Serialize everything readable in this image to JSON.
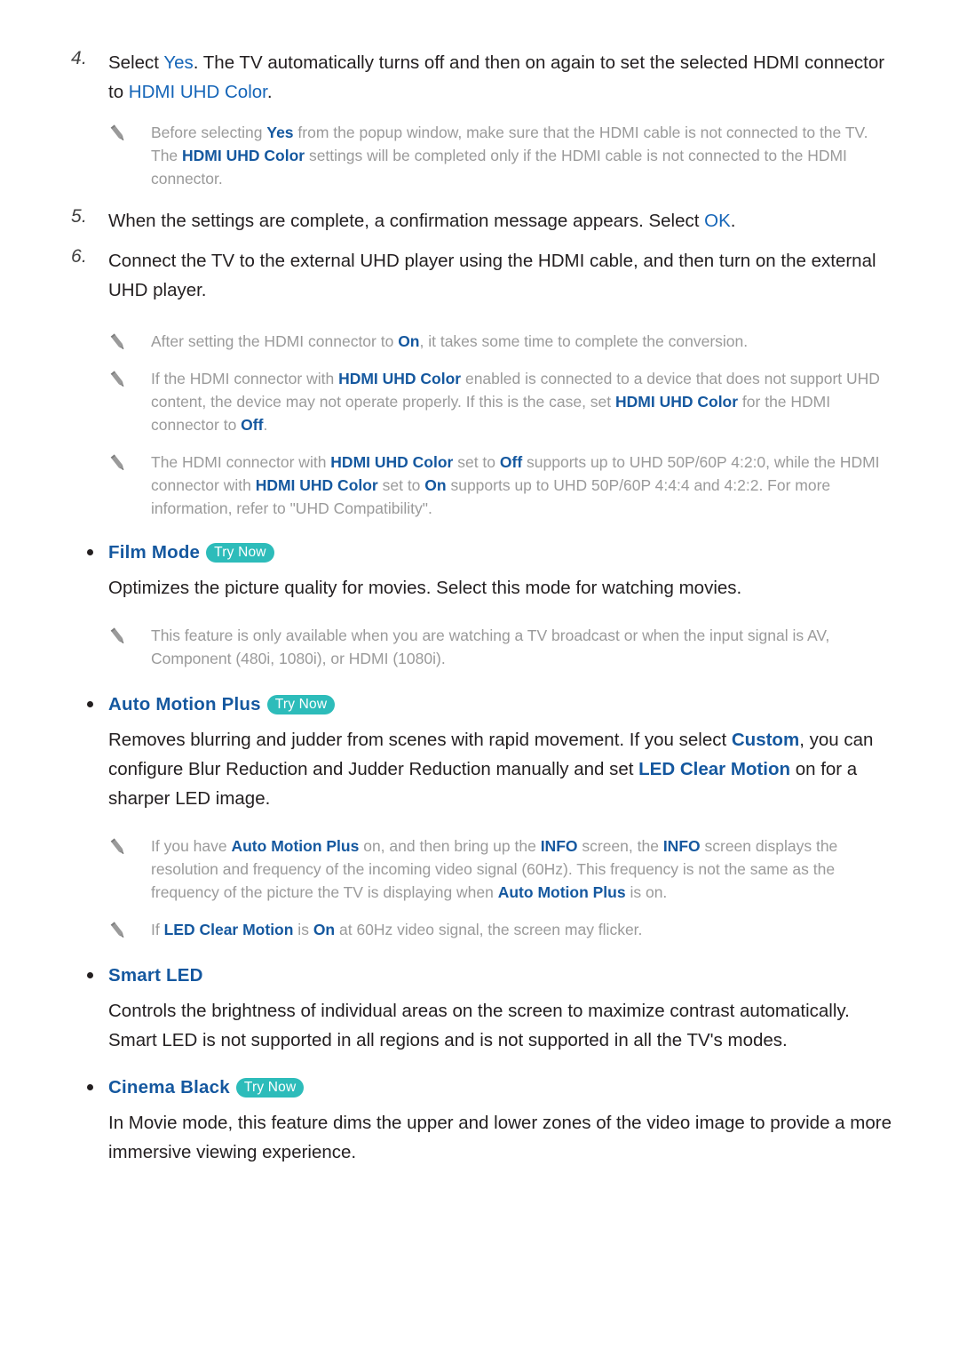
{
  "page": {
    "accent_blue": "#1565b8",
    "accent_blue_bold": "#15589f",
    "badge_teal": "#2dbcba",
    "note_gray": "#9a9a9a",
    "body_dark": "#231f20"
  },
  "steps": [
    {
      "number": "4.",
      "text_before": "Select ",
      "link1": "Yes",
      "text_mid": ". The TV automatically turns off and then on again to set the selected HDMI connector to ",
      "link2": "HDMI UHD Color",
      "text_after": "."
    },
    {
      "number": "5.",
      "text_before": "When the settings are complete, a confirmation message appears. Select ",
      "link1": "OK",
      "text_mid": "",
      "link2": "",
      "text_after": "."
    },
    {
      "number": "6.",
      "text_before": "Connect the TV to the external UHD player using the HDMI cable, and then turn on the external UHD player.",
      "link1": "",
      "text_mid": "",
      "link2": "",
      "text_after": ""
    }
  ],
  "notes": {
    "note_step4": {
      "icon": "pencil-icon",
      "segments": [
        {
          "t": "Before selecting ",
          "b": false
        },
        {
          "t": "Yes",
          "b": true
        },
        {
          "t": " from the popup window, make sure that the HDMI cable is not connected to the TV. The ",
          "b": false
        },
        {
          "t": "HDMI UHD Color",
          "b": true
        },
        {
          "t": " settings will be completed only if the HDMI cable is not connected to the HDMI connector.",
          "b": false
        }
      ]
    },
    "note_step6_a": {
      "icon": "pencil-icon",
      "segments": [
        {
          "t": "After setting the HDMI connector to ",
          "b": false
        },
        {
          "t": "On",
          "b": true
        },
        {
          "t": ", it takes some time to complete the conversion.",
          "b": false
        }
      ]
    },
    "note_step6_b": {
      "icon": "pencil-icon",
      "segments": [
        {
          "t": "If the HDMI connector with ",
          "b": false
        },
        {
          "t": "HDMI UHD Color",
          "b": true
        },
        {
          "t": " enabled is connected to a device that does not support UHD content, the device may not operate properly. If this is the case, set ",
          "b": false
        },
        {
          "t": "HDMI UHD Color",
          "b": true
        },
        {
          "t": " for the HDMI connector to ",
          "b": false
        },
        {
          "t": "Off",
          "b": true
        },
        {
          "t": ".",
          "b": false
        }
      ]
    },
    "note_step6_c": {
      "icon": "pencil-icon",
      "segments": [
        {
          "t": "The HDMI connector with ",
          "b": false
        },
        {
          "t": "HDMI UHD Color",
          "b": true
        },
        {
          "t": " set to ",
          "b": false
        },
        {
          "t": "Off",
          "b": true
        },
        {
          "t": " supports up to UHD 50P/60P 4:2:0, while the HDMI connector with ",
          "b": false
        },
        {
          "t": "HDMI UHD Color",
          "b": true
        },
        {
          "t": " set to ",
          "b": false
        },
        {
          "t": "On",
          "b": true
        },
        {
          "t": " supports up to UHD 50P/60P 4:4:4 and 4:2:2. For more information, refer to \"UHD Compatibility\".",
          "b": false
        }
      ]
    },
    "note_film_mode": {
      "icon": "pencil-icon",
      "segments": [
        {
          "t": "This feature is only available when you are watching a TV broadcast or when the input signal is AV, Component (480i, 1080i), or HDMI (1080i).",
          "b": false
        }
      ]
    },
    "note_amp_a": {
      "icon": "pencil-icon",
      "segments": [
        {
          "t": "If you have ",
          "b": false
        },
        {
          "t": "Auto Motion Plus",
          "b": true
        },
        {
          "t": " on, and then bring up the ",
          "b": false
        },
        {
          "t": "INFO",
          "b": true
        },
        {
          "t": " screen, the ",
          "b": false
        },
        {
          "t": "INFO",
          "b": true
        },
        {
          "t": " screen displays the resolution and frequency of the incoming video signal (60Hz). This frequency is not the same as the frequency of the picture the TV is displaying when ",
          "b": false
        },
        {
          "t": "Auto Motion Plus",
          "b": true
        },
        {
          "t": " is on.",
          "b": false
        }
      ]
    },
    "note_amp_b": {
      "icon": "pencil-icon",
      "segments": [
        {
          "t": "If ",
          "b": false
        },
        {
          "t": "LED Clear Motion",
          "b": true
        },
        {
          "t": " is ",
          "b": false
        },
        {
          "t": "On",
          "b": true
        },
        {
          "t": " at 60Hz video signal, the screen may flicker.",
          "b": false
        }
      ]
    }
  },
  "features": [
    {
      "title": "Film Mode",
      "badge": "Try Now",
      "has_badge": true,
      "body_segments": [
        {
          "t": "Optimizes the picture quality for movies. Select this mode for watching movies.",
          "b": false
        }
      ]
    },
    {
      "title": "Auto Motion Plus",
      "badge": "Try Now",
      "has_badge": true,
      "body_segments": [
        {
          "t": "Removes blurring and judder from scenes with rapid movement. If you select ",
          "b": false
        },
        {
          "t": "Custom",
          "b": true
        },
        {
          "t": ", you can configure Blur Reduction and Judder Reduction manually and set ",
          "b": false
        },
        {
          "t": "LED Clear Motion",
          "b": true
        },
        {
          "t": " on for a sharper LED image.",
          "b": false
        }
      ]
    },
    {
      "title": "Smart LED",
      "badge": "",
      "has_badge": false,
      "body_segments": [
        {
          "t": "Controls the brightness of individual areas on the screen to maximize contrast automatically. Smart LED is not supported in all regions and is not supported in all the TV's modes.",
          "b": false
        }
      ]
    },
    {
      "title": "Cinema Black",
      "badge": "Try Now",
      "has_badge": true,
      "body_segments": [
        {
          "t": "In Movie mode, this feature dims the upper and lower zones of the video image to provide a more immersive viewing experience.",
          "b": false
        }
      ]
    }
  ]
}
